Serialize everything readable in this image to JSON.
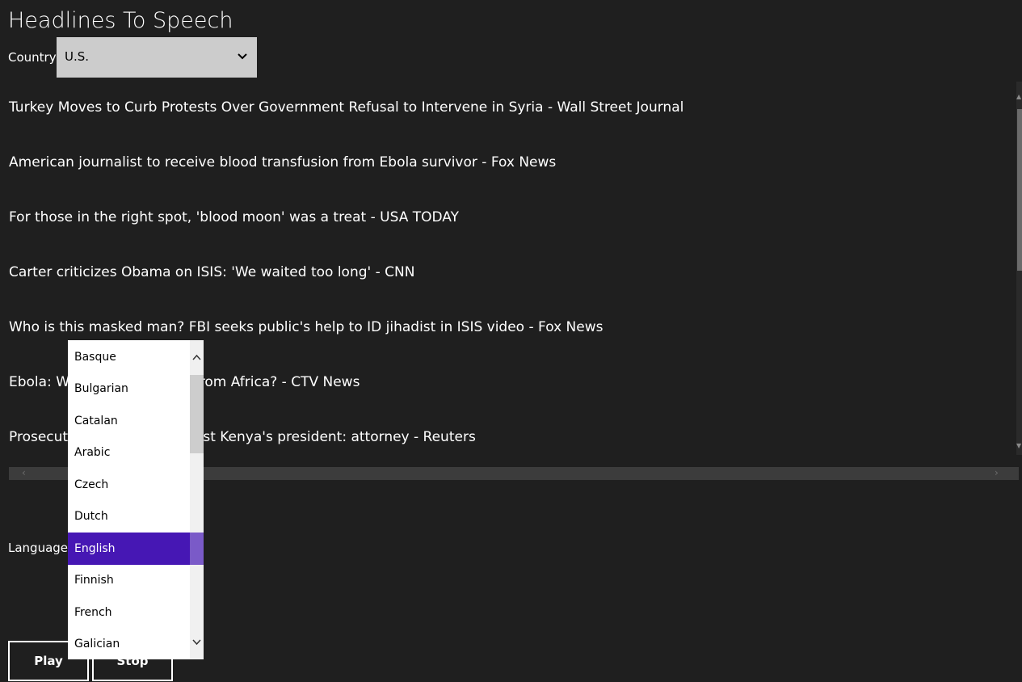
{
  "app": {
    "title": "Headlines To Speech"
  },
  "country": {
    "label": "Country:",
    "selected": "U.S."
  },
  "headlines": [
    "Turkey Moves to Curb Protests Over Government Refusal to Intervene in Syria - Wall Street Journal",
    "American journalist to receive blood transfusion from Ebola survivor - Fox News",
    "For those in the right spot, 'blood moon' was a treat - USA TODAY",
    "Carter criticizes Obama on ISIS: 'We waited too long' - CNN",
    "Who is this masked man? FBI seeks public's help to ID jihadist in ISIS video - Fox News",
    "Ebola: Why not ban flights from Africa? - CTV News",
    "Prosecutors drop case against Kenya's president: attorney - Reuters"
  ],
  "language": {
    "label": "Language:",
    "options": [
      "Basque",
      "Bulgarian",
      "Catalan",
      "Arabic",
      "Czech",
      "Dutch",
      "English",
      "Finnish",
      "French",
      "Galician"
    ],
    "selected": "English"
  },
  "buttons": {
    "play": "Play",
    "stop": "Stop"
  },
  "colors": {
    "background": "#1f1f1f",
    "accent": "#4617b4",
    "select_bg": "#cccccc"
  }
}
